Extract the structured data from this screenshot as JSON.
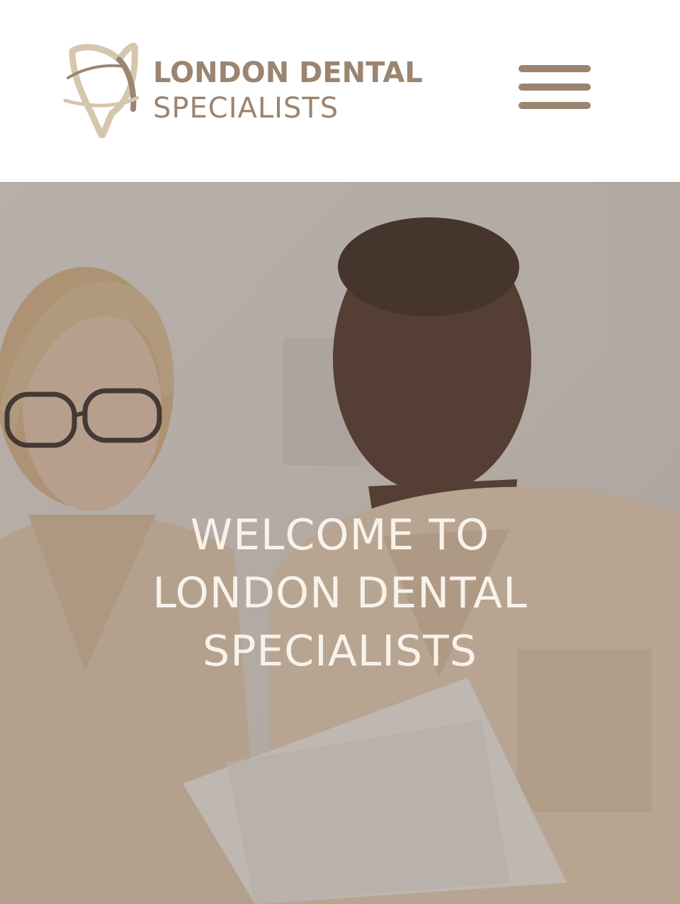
{
  "header": {
    "logo": {
      "line1": "LONDON DENTAL",
      "line2": "SPECIALISTS",
      "icon": "tooth-logo-icon"
    },
    "menu_icon": "hamburger-menu-icon"
  },
  "hero": {
    "title_lines": [
      "WELCOME TO",
      "LONDON DENTAL",
      "SPECIALISTS"
    ]
  },
  "colors": {
    "brand": "#9b8470",
    "brand_light": "#d6c6ae",
    "hero_text": "#f8f2ea",
    "header_bg": "#ffffff"
  }
}
